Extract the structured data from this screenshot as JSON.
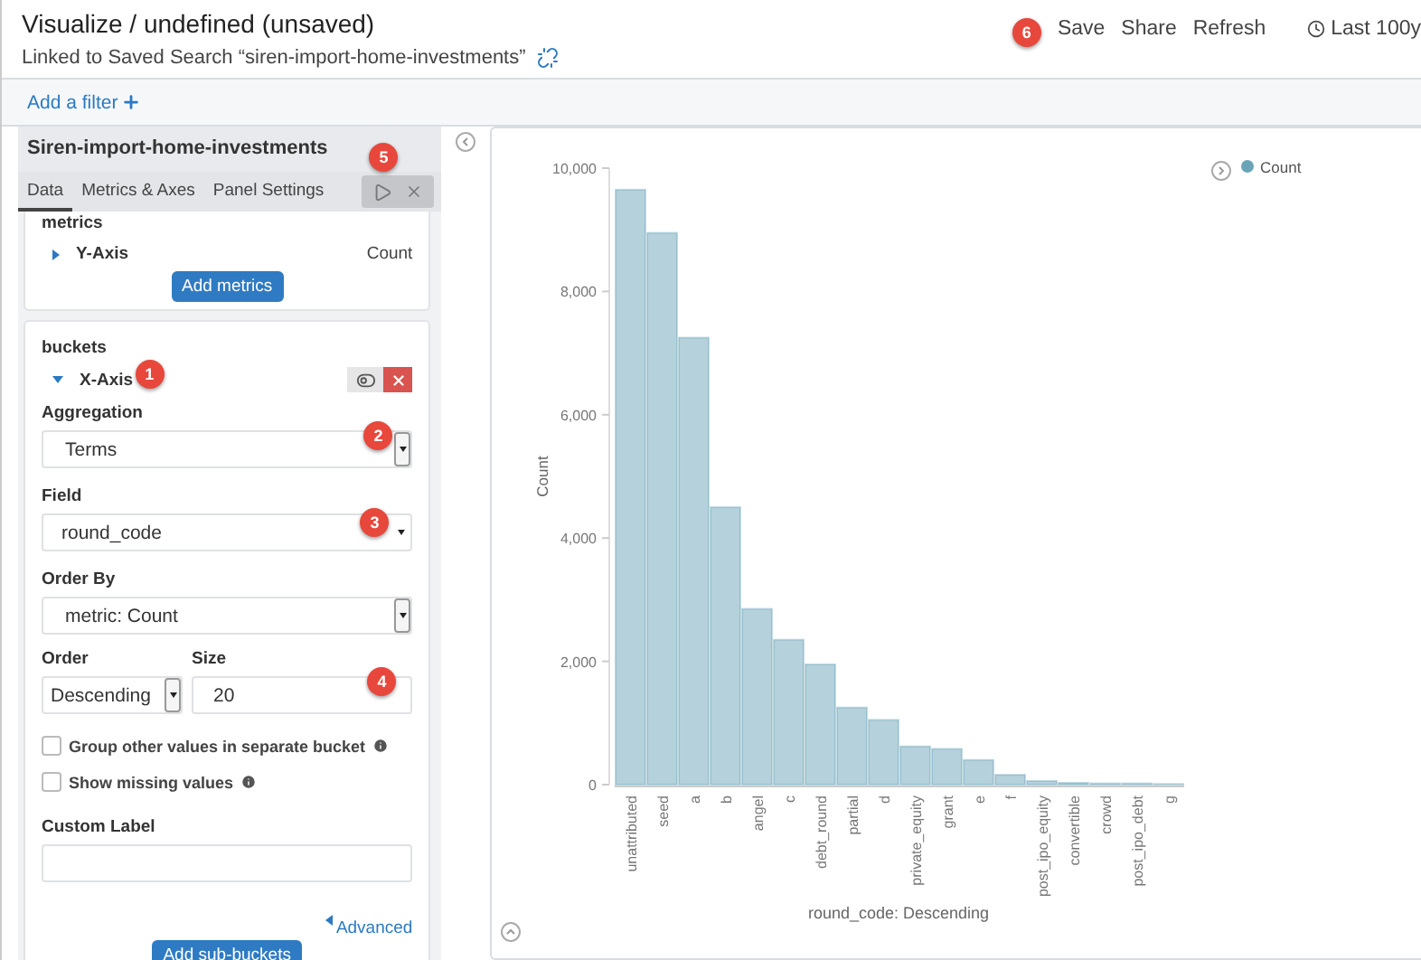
{
  "header": {
    "title": "Visualize / undefined (unsaved)",
    "linked_search": "Linked to Saved Search “siren-import-home-investments”"
  },
  "top_menu": {
    "items": [
      {
        "label": "Save",
        "callout": "6"
      },
      {
        "label": "Share"
      },
      {
        "label": "Refresh"
      }
    ],
    "time_range": "Last 100y"
  },
  "filter_bar": {
    "add_filter": "Add a filter"
  },
  "sidebar": {
    "title": "Siren-import-home-investments",
    "callout": "5",
    "tabs": [
      {
        "label": "Data",
        "selected": true
      },
      {
        "label": "Metrics & Axes",
        "selected": false
      },
      {
        "label": "Panel Settings",
        "selected": false
      }
    ],
    "metrics": {
      "heading": "metrics",
      "items": [
        {
          "label": "Y-Axis",
          "value": "Count",
          "expanded": false
        }
      ],
      "add_button": "Add metrics"
    },
    "buckets": {
      "heading": "buckets",
      "items": [
        {
          "label": "X-Axis",
          "expanded": true,
          "callout": "1"
        }
      ],
      "aggregation": {
        "label": "Aggregation",
        "value": "Terms",
        "callout": "2"
      },
      "field": {
        "label": "Field",
        "value": "round_code",
        "callout": "3"
      },
      "order_by": {
        "label": "Order By",
        "value": "metric: Count"
      },
      "order": {
        "label": "Order",
        "value": "Descending"
      },
      "size": {
        "label": "Size",
        "value": "20",
        "callout": "4"
      },
      "options": [
        {
          "label": "Group other values in separate bucket",
          "checked": false
        },
        {
          "label": "Show missing values",
          "checked": false
        }
      ],
      "custom_label": {
        "label": "Custom Label"
      },
      "advanced_link": "Advanced",
      "add_button": "Add sub-buckets"
    }
  },
  "chart_data": {
    "type": "bar",
    "ylabel": "Count",
    "xlabel": "round_code: Descending",
    "categories": [
      "unattributed",
      "seed",
      "a",
      "b",
      "angel",
      "c",
      "debt_round",
      "partial",
      "d",
      "private_equity",
      "grant",
      "e",
      "f",
      "post_ipo_equity",
      "convertible",
      "crowd",
      "post_ipo_debt",
      "g"
    ],
    "series": [
      {
        "name": "Count",
        "color": "#6ba4b8",
        "values": [
          9650,
          8950,
          7250,
          4500,
          2850,
          2350,
          1950,
          1250,
          1050,
          620,
          580,
          400,
          160,
          60,
          30,
          20,
          20,
          10
        ]
      }
    ],
    "ylim": [
      0,
      10000
    ],
    "yticks": [
      {
        "value": 0,
        "label": "0"
      },
      {
        "value": 2000,
        "label": "2,000"
      },
      {
        "value": 4000,
        "label": "4,000"
      },
      {
        "value": 6000,
        "label": "6,000"
      },
      {
        "value": 8000,
        "label": "8,000"
      },
      {
        "value": 10000,
        "label": "10,000"
      }
    ]
  }
}
